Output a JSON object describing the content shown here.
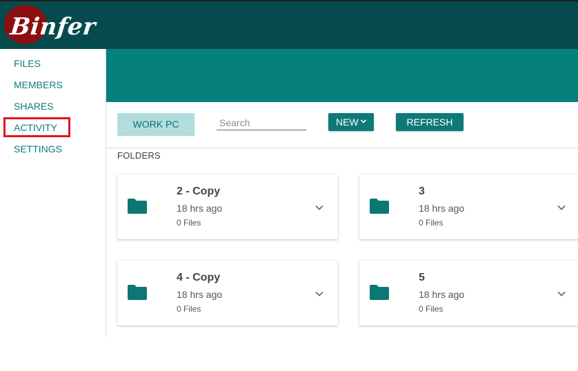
{
  "app": {
    "logo_text": "Binfer",
    "colors": {
      "header": "#054b4d",
      "banner": "#05807b",
      "accent": "#0d7a78",
      "logo_red": "#8b0f10",
      "highlight": "#e1141b"
    }
  },
  "sidebar": {
    "items": [
      {
        "label": "FILES"
      },
      {
        "label": "MEMBERS"
      },
      {
        "label": "SHARES"
      },
      {
        "label": "ACTIVITY"
      },
      {
        "label": "SETTINGS"
      }
    ],
    "highlighted": "ACTIVITY"
  },
  "toolbar": {
    "device_label": "WORK PC",
    "search_placeholder": "Search",
    "search_value": "",
    "new_label": "NEW",
    "refresh_label": "REFRESH"
  },
  "folders": {
    "section_label": "FOLDERS",
    "items": [
      {
        "name": "2 - Copy",
        "modified": "18 hrs ago",
        "files": "0 Files",
        "icon": "folder-icon"
      },
      {
        "name": "3",
        "modified": "18 hrs ago",
        "files": "0 Files",
        "icon": "folder-icon"
      },
      {
        "name": "4 - Copy",
        "modified": "18 hrs ago",
        "files": "0 Files",
        "icon": "folder-icon"
      },
      {
        "name": "5",
        "modified": "18 hrs ago",
        "files": "0 Files",
        "icon": "folder-icon"
      }
    ]
  }
}
